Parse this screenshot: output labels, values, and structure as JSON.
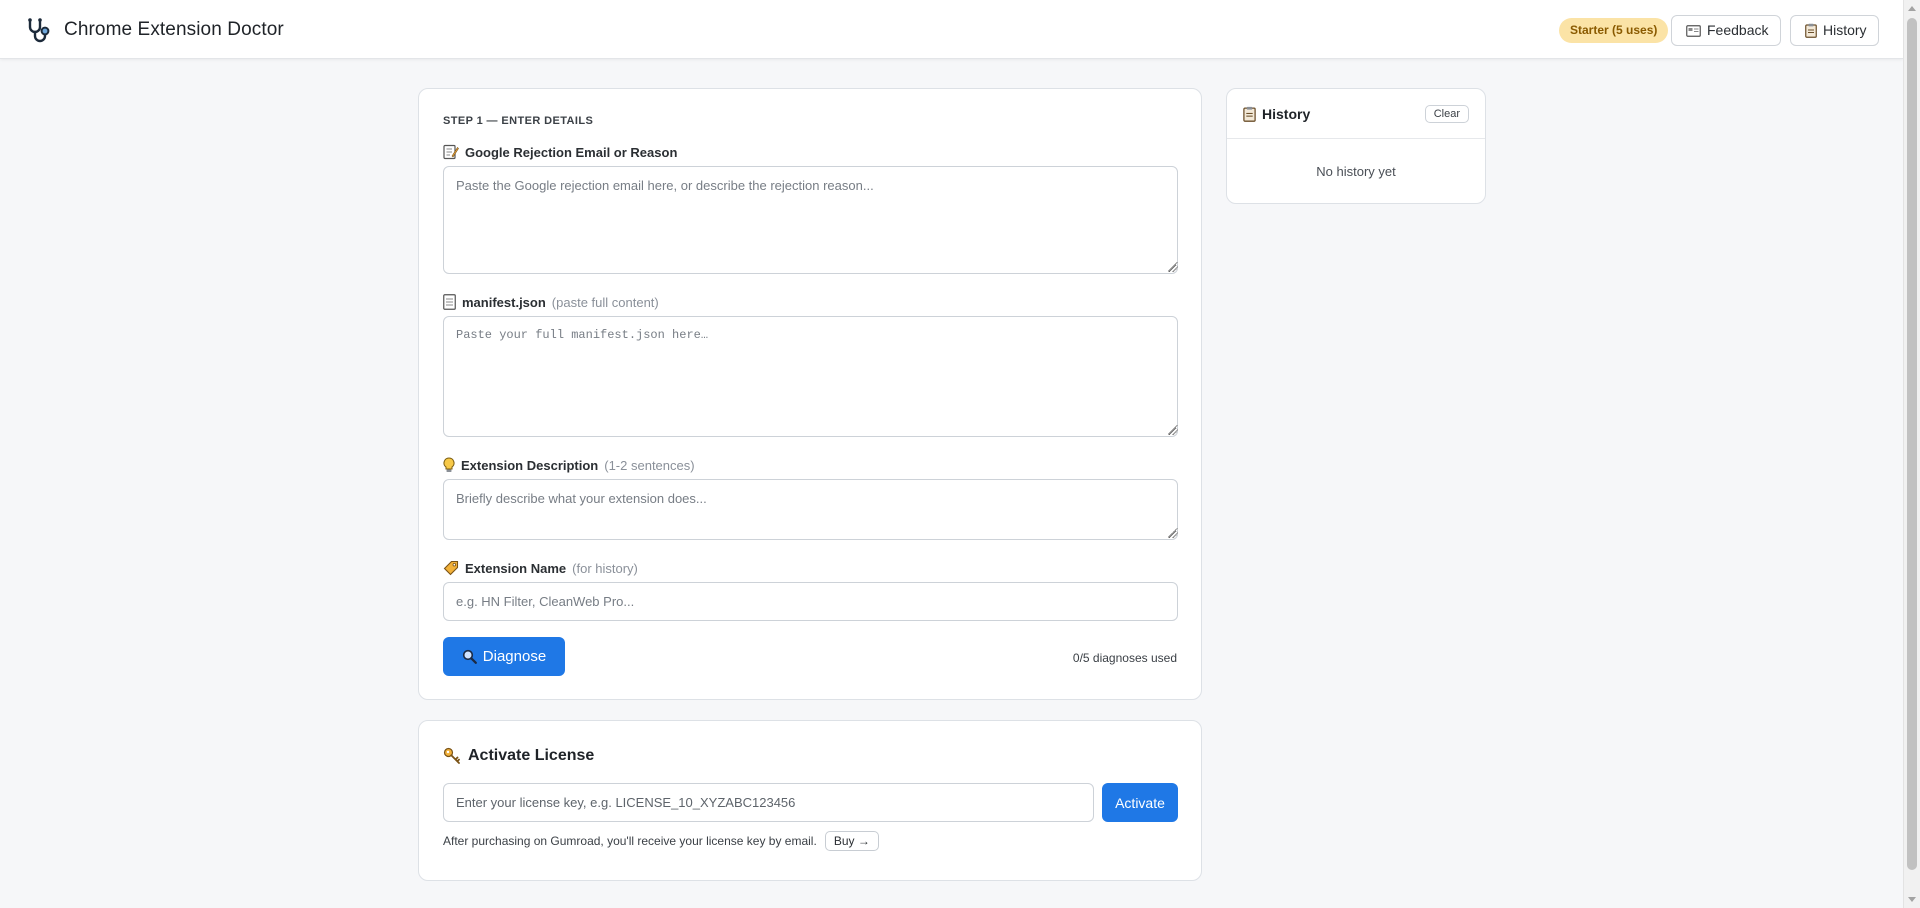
{
  "header": {
    "app_title": "Chrome Extension Doctor",
    "plan_badge": "Starter (5 uses)",
    "feedback_label": "Feedback",
    "history_label": "History"
  },
  "form": {
    "step_label": "STEP 1 — ENTER DETAILS",
    "rejection": {
      "label": "Google Rejection Email or Reason",
      "hint": "",
      "placeholder": "Paste the Google rejection email here, or describe the rejection reason...",
      "value": ""
    },
    "manifest": {
      "label": "manifest.json",
      "hint": "(paste full content)",
      "placeholder": "Paste your full manifest.json here…",
      "value": ""
    },
    "description": {
      "label": "Extension Description",
      "hint": "(1-2 sentences)",
      "placeholder": "Briefly describe what your extension does...",
      "value": ""
    },
    "name": {
      "label": "Extension Name",
      "hint": "(for history)",
      "placeholder": "e.g. HN Filter, CleanWeb Pro...",
      "value": ""
    },
    "diagnose_label": "Diagnose",
    "usage": "0/5 diagnoses used"
  },
  "license": {
    "title": "Activate License",
    "placeholder": "Enter your license key, e.g. LICENSE_10_XYZABC123456",
    "value": "",
    "activate_label": "Activate",
    "note": "After purchasing on Gumroad, you'll receive your license key by email.",
    "buy_label": "Buy →"
  },
  "history_panel": {
    "title": "History",
    "clear_label": "Clear",
    "empty_text": "No history yet"
  },
  "colors": {
    "accent": "#1f78e6",
    "badge_bg": "#fbe3a6",
    "badge_text": "#8a5a00",
    "page_bg": "#f6f7f9"
  },
  "icons": {
    "logo": "stethoscope-icon",
    "feedback": "envelope-icon",
    "history": "clipboard-icon",
    "rejection": "memo-icon",
    "manifest": "document-icon",
    "description": "lightbulb-icon",
    "name": "tag-icon",
    "diagnose": "magnifier-icon",
    "license": "key-icon"
  }
}
